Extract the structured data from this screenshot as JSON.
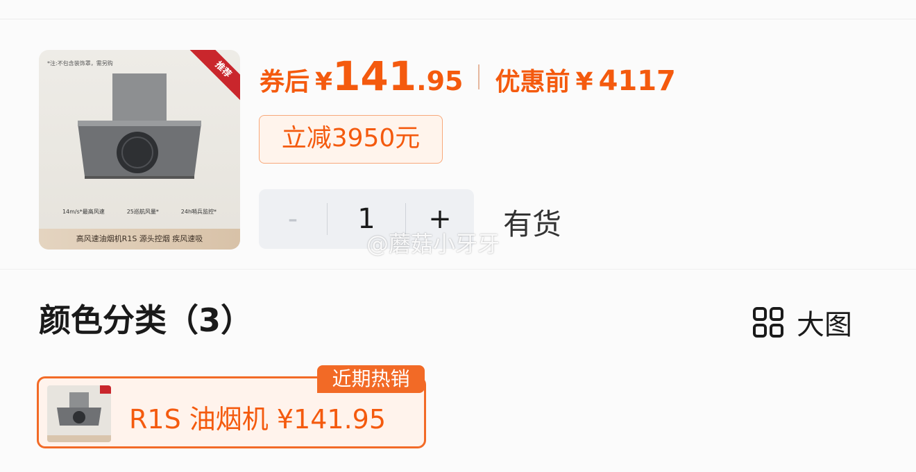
{
  "product": {
    "image_note": "*注:不包含装饰罩，需另购",
    "ribbon": "推荐",
    "features": [
      "14m/s*最高风速",
      "25巡航风量*",
      "24h哨兵监控*"
    ],
    "caption": "高风速油烟机R1S 源头控烟 疾风速吸"
  },
  "price": {
    "after_coupon_label": "券后",
    "currency": "¥",
    "after_coupon_int": "141",
    "after_coupon_dec": ".95",
    "original_label": "优惠前",
    "original_value": "4117",
    "discount_tag": "立减3950元"
  },
  "quantity": {
    "minus": "-",
    "value": "1",
    "plus": "+"
  },
  "stock_status": "有货",
  "watermark": "@蘑菇小牙牙",
  "variants_section": {
    "title": "颜色分类（3）",
    "view_toggle_label": "大图",
    "variants": [
      {
        "label": "R1S 油烟机  ¥141.95",
        "badge": "近期热销"
      }
    ]
  },
  "colors": {
    "accent": "#f45a0e",
    "accent_border": "#f26a26"
  },
  "icons": {
    "grid_view": "grid-icon"
  }
}
